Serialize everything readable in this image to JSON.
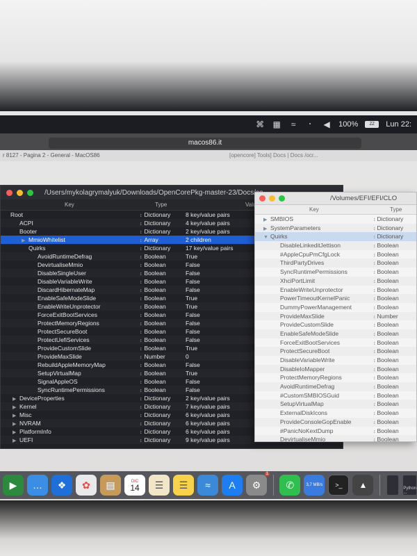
{
  "menubar": {
    "battery_percent": "100%",
    "battery_label": "ZZ",
    "clock": "Lun 22:",
    "icons": [
      "command-icon",
      "grid-icon",
      "wifi-icon",
      "bluetooth-icon",
      "volume-icon"
    ]
  },
  "browser": {
    "url": "macos86.it",
    "tab1": "r 8127 - Pagina 2 - General - MacOS86",
    "tab2": "[opencore] Tools] Docs | Docs /ocr..."
  },
  "main_window": {
    "title": "/Users/mykolagrymalyuk/Downloads/OpenCorePkg-master-23/Docs/co",
    "columns": {
      "key": "Key",
      "type": "Type",
      "value": "Valu"
    },
    "rows": [
      {
        "key": "Root",
        "type": "Dictionary",
        "value": "8 key/value pairs",
        "indent": 0,
        "tri": ""
      },
      {
        "key": "ACPI",
        "type": "Dictionary",
        "value": "4 key/value pairs",
        "indent": 1,
        "tri": ""
      },
      {
        "key": "Booter",
        "type": "Dictionary",
        "value": "2 key/value pairs",
        "indent": 1,
        "tri": ""
      },
      {
        "key": "MmioWhitelist",
        "type": "Array",
        "value": "2 children",
        "indent": 2,
        "tri": "▶"
      },
      {
        "key": "Quirks",
        "type": "Dictionary",
        "value": "17 key/value pairs",
        "indent": 2,
        "tri": ""
      },
      {
        "key": "AvoidRuntimeDefrag",
        "type": "Boolean",
        "value": "True",
        "indent": 3,
        "tri": ""
      },
      {
        "key": "DevirtualiseMmio",
        "type": "Boolean",
        "value": "False",
        "indent": 3,
        "tri": ""
      },
      {
        "key": "DisableSingleUser",
        "type": "Boolean",
        "value": "False",
        "indent": 3,
        "tri": ""
      },
      {
        "key": "DisableVariableWrite",
        "type": "Boolean",
        "value": "False",
        "indent": 3,
        "tri": ""
      },
      {
        "key": "DiscardHibernateMap",
        "type": "Boolean",
        "value": "False",
        "indent": 3,
        "tri": ""
      },
      {
        "key": "EnableSafeModeSlide",
        "type": "Boolean",
        "value": "True",
        "indent": 3,
        "tri": ""
      },
      {
        "key": "EnableWriteUnprotector",
        "type": "Boolean",
        "value": "True",
        "indent": 3,
        "tri": ""
      },
      {
        "key": "ForceExitBootServices",
        "type": "Boolean",
        "value": "False",
        "indent": 3,
        "tri": ""
      },
      {
        "key": "ProtectMemoryRegions",
        "type": "Boolean",
        "value": "False",
        "indent": 3,
        "tri": ""
      },
      {
        "key": "ProtectSecureBoot",
        "type": "Boolean",
        "value": "False",
        "indent": 3,
        "tri": ""
      },
      {
        "key": "ProtectUefiServices",
        "type": "Boolean",
        "value": "False",
        "indent": 3,
        "tri": ""
      },
      {
        "key": "ProvideCustomSlide",
        "type": "Boolean",
        "value": "True",
        "indent": 3,
        "tri": ""
      },
      {
        "key": "ProvideMaxSlide",
        "type": "Number",
        "value": "0",
        "indent": 3,
        "tri": ""
      },
      {
        "key": "RebuildAppleMemoryMap",
        "type": "Boolean",
        "value": "False",
        "indent": 3,
        "tri": ""
      },
      {
        "key": "SetupVirtualMap",
        "type": "Boolean",
        "value": "True",
        "indent": 3,
        "tri": ""
      },
      {
        "key": "SignalAppleOS",
        "type": "Boolean",
        "value": "False",
        "indent": 3,
        "tri": ""
      },
      {
        "key": "SyncRuntimePermissions",
        "type": "Boolean",
        "value": "False",
        "indent": 3,
        "tri": ""
      },
      {
        "key": "DeviceProperties",
        "type": "Dictionary",
        "value": "2 key/value pairs",
        "indent": 1,
        "tri": "▶"
      },
      {
        "key": "Kernel",
        "type": "Dictionary",
        "value": "7 key/value pairs",
        "indent": 1,
        "tri": "▶"
      },
      {
        "key": "Misc",
        "type": "Dictionary",
        "value": "6 key/value pairs",
        "indent": 1,
        "tri": "▶"
      },
      {
        "key": "NVRAM",
        "type": "Dictionary",
        "value": "6 key/value pairs",
        "indent": 1,
        "tri": "▶"
      },
      {
        "key": "PlatformInfo",
        "type": "Dictionary",
        "value": "6 key/value pairs",
        "indent": 1,
        "tri": "▶"
      },
      {
        "key": "UEFI",
        "type": "Dictionary",
        "value": "9 key/value pairs",
        "indent": 1,
        "tri": "▶"
      }
    ]
  },
  "front_window": {
    "title": "/Volumes/EFI/EFI/CLO",
    "columns": {
      "key": "Key",
      "type": "Type"
    },
    "rows": [
      {
        "key": "SMBIOS",
        "type": "Dictionary",
        "indent": 0,
        "tri": "▶"
      },
      {
        "key": "SystemParameters",
        "type": "Dictionary",
        "indent": 0,
        "tri": "▶"
      },
      {
        "key": "Quirks",
        "type": "Dictionary",
        "indent": 0,
        "tri": "▼"
      },
      {
        "key": "DisableLinkeditJettison",
        "type": "Boolean",
        "indent": 1,
        "tri": ""
      },
      {
        "key": "#AppleCpuPmCfgLock",
        "type": "Boolean",
        "indent": 1,
        "tri": ""
      },
      {
        "key": "ThirdPartyDrives",
        "type": "Boolean",
        "indent": 1,
        "tri": ""
      },
      {
        "key": "SyncRuntimePermissions",
        "type": "Boolean",
        "indent": 1,
        "tri": ""
      },
      {
        "key": "XhciPortLimit",
        "type": "Boolean",
        "indent": 1,
        "tri": ""
      },
      {
        "key": "EnableWriteUnprotector",
        "type": "Boolean",
        "indent": 1,
        "tri": ""
      },
      {
        "key": "PowerTimeoutKernelPanic",
        "type": "Boolean",
        "indent": 1,
        "tri": ""
      },
      {
        "key": "DummyPowerManagement",
        "type": "Boolean",
        "indent": 1,
        "tri": ""
      },
      {
        "key": "ProvideMaxSlide",
        "type": "Number",
        "indent": 1,
        "tri": ""
      },
      {
        "key": "ProvideCustomSlide",
        "type": "Boolean",
        "indent": 1,
        "tri": ""
      },
      {
        "key": "EnableSafeModeSlide",
        "type": "Boolean",
        "indent": 1,
        "tri": ""
      },
      {
        "key": "ForceExitBootServices",
        "type": "Boolean",
        "indent": 1,
        "tri": ""
      },
      {
        "key": "ProtectSecureBoot",
        "type": "Boolean",
        "indent": 1,
        "tri": ""
      },
      {
        "key": "DisableVariableWrite",
        "type": "Boolean",
        "indent": 1,
        "tri": ""
      },
      {
        "key": "DisableIoMapper",
        "type": "Boolean",
        "indent": 1,
        "tri": ""
      },
      {
        "key": "ProtectMemoryRegions",
        "type": "Boolean",
        "indent": 1,
        "tri": ""
      },
      {
        "key": "AvoidRuntimeDefrag",
        "type": "Boolean",
        "indent": 1,
        "tri": ""
      },
      {
        "key": "#CustomSMBIOSGuid",
        "type": "Boolean",
        "indent": 1,
        "tri": ""
      },
      {
        "key": "SetupVirtualMap",
        "type": "Boolean",
        "indent": 1,
        "tri": ""
      },
      {
        "key": "ExternalDiskIcons",
        "type": "Boolean",
        "indent": 1,
        "tri": ""
      },
      {
        "key": "ProvideConsoleGopEnable",
        "type": "Boolean",
        "indent": 1,
        "tri": ""
      },
      {
        "key": "#PanicNoKextDump",
        "type": "Boolean",
        "indent": 1,
        "tri": ""
      },
      {
        "key": "DevirtualiseMmio",
        "type": "Boolean",
        "indent": 1,
        "tri": ""
      }
    ]
  },
  "dock": {
    "calendar_month": "DIC",
    "calendar_day": "14",
    "mail_badge": "1",
    "whatsapp_badge": "3,7 MB/s",
    "thumb_label": "Python ..."
  }
}
